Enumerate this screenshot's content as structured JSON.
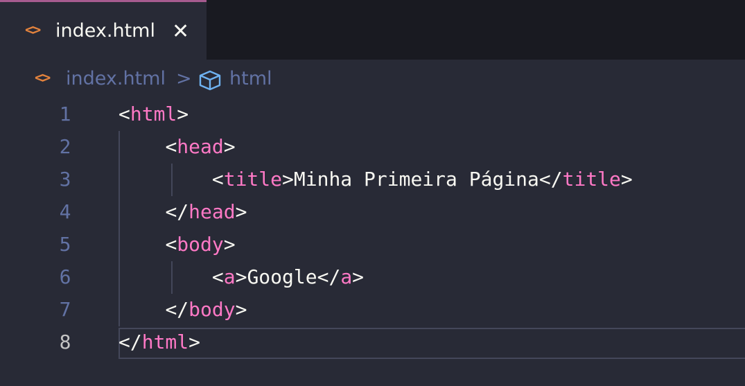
{
  "tabs": [
    {
      "icon": "html-file-icon",
      "label": "index.html",
      "close": "✕"
    }
  ],
  "breadcrumb": {
    "file": "index.html",
    "separator": ">",
    "symbol": "html"
  },
  "editor": {
    "lines": [
      {
        "number": "1",
        "indent": "",
        "tokens": [
          [
            "p",
            "<"
          ],
          [
            "t",
            "html"
          ],
          [
            "p",
            ">"
          ]
        ]
      },
      {
        "number": "2",
        "indent": "    ",
        "tokens": [
          [
            "p",
            "<"
          ],
          [
            "t",
            "head"
          ],
          [
            "p",
            ">"
          ]
        ]
      },
      {
        "number": "3",
        "indent": "        ",
        "tokens": [
          [
            "p",
            "<"
          ],
          [
            "t",
            "title"
          ],
          [
            "p",
            ">"
          ],
          [
            "txt",
            "Minha Primeira Página"
          ],
          [
            "p",
            "</"
          ],
          [
            "t",
            "title"
          ],
          [
            "p",
            ">"
          ]
        ]
      },
      {
        "number": "4",
        "indent": "    ",
        "tokens": [
          [
            "p",
            "</"
          ],
          [
            "t",
            "head"
          ],
          [
            "p",
            ">"
          ]
        ]
      },
      {
        "number": "5",
        "indent": "    ",
        "tokens": [
          [
            "p",
            "<"
          ],
          [
            "t",
            "body"
          ],
          [
            "p",
            ">"
          ]
        ]
      },
      {
        "number": "6",
        "indent": "        ",
        "tokens": [
          [
            "p",
            "<"
          ],
          [
            "t",
            "a"
          ],
          [
            "p",
            ">"
          ],
          [
            "txt",
            "Google"
          ],
          [
            "p",
            "</"
          ],
          [
            "t",
            "a"
          ],
          [
            "p",
            ">"
          ]
        ]
      },
      {
        "number": "7",
        "indent": "    ",
        "tokens": [
          [
            "p",
            "</"
          ],
          [
            "t",
            "body"
          ],
          [
            "p",
            ">"
          ]
        ]
      },
      {
        "number": "8",
        "indent": "",
        "tokens": [
          [
            "p",
            "</"
          ],
          [
            "t",
            "html"
          ],
          [
            "p",
            ">"
          ]
        ]
      }
    ],
    "active_line": "8"
  },
  "colors": {
    "background": "#282a36",
    "tabbar": "#191a21",
    "tag": "#ff79c6",
    "text": "#f8f8f2",
    "muted": "#6272a4",
    "html_icon": "#e2823d",
    "accent": "#a65b8f"
  }
}
